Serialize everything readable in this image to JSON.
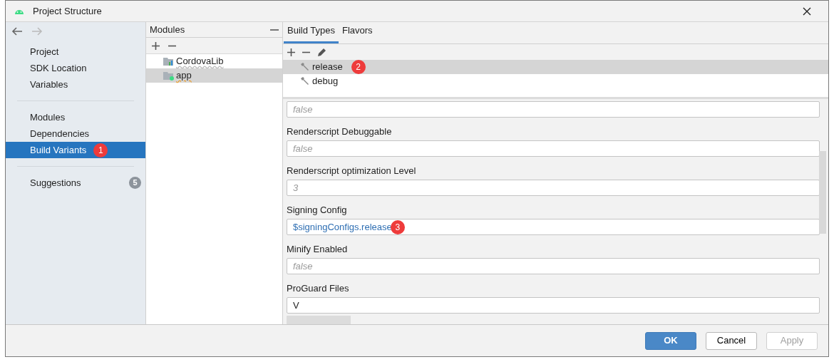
{
  "window": {
    "title": "Project Structure"
  },
  "sidebar": {
    "groups": [
      {
        "items": [
          {
            "label": "Project",
            "selected": false
          },
          {
            "label": "SDK Location",
            "selected": false
          },
          {
            "label": "Variables",
            "selected": false
          }
        ]
      },
      {
        "items": [
          {
            "label": "Modules",
            "selected": false
          },
          {
            "label": "Dependencies",
            "selected": false
          },
          {
            "label": "Build Variants",
            "selected": true,
            "annotation": "1"
          }
        ]
      },
      {
        "items": [
          {
            "label": "Suggestions",
            "selected": false,
            "count": "5"
          }
        ]
      }
    ]
  },
  "modules": {
    "title": "Modules",
    "items": [
      {
        "label": "CordovaLib",
        "kind": "library",
        "selected": false
      },
      {
        "label": "app",
        "kind": "app",
        "selected": true
      }
    ]
  },
  "tabs": [
    {
      "label": "Build Types",
      "selected": true
    },
    {
      "label": "Flavors",
      "selected": false
    }
  ],
  "build_types": [
    {
      "label": "release",
      "selected": true,
      "annotation": "2"
    },
    {
      "label": "debug",
      "selected": false
    }
  ],
  "properties": [
    {
      "placeholder": "false"
    },
    {
      "label": "Renderscript Debuggable",
      "placeholder": "false"
    },
    {
      "label": "Renderscript optimization Level",
      "placeholder": "3"
    },
    {
      "label": "Signing Config",
      "value": "$signingConfigs.release",
      "annotation": "3"
    },
    {
      "label": "Minify Enabled",
      "placeholder": "false"
    },
    {
      "label": "ProGuard Files",
      "value": "V"
    }
  ],
  "buttons": [
    {
      "label": "OK",
      "kind": "primary",
      "disabled": false
    },
    {
      "label": "Cancel",
      "kind": "normal",
      "disabled": false
    },
    {
      "label": "Apply",
      "kind": "normal",
      "disabled": true
    }
  ]
}
